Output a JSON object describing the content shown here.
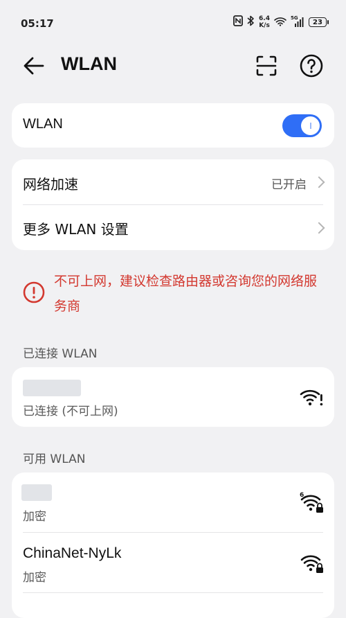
{
  "status_bar": {
    "time": "05:17",
    "net_speed_value": "6.4",
    "net_speed_unit": "K/s",
    "signal_label": "5G",
    "battery": "23"
  },
  "header": {
    "title": "WLAN"
  },
  "wlan_toggle": {
    "label": "WLAN",
    "state": "on"
  },
  "settings": {
    "accel_label": "网络加速",
    "accel_value": "已开启",
    "more_label": "更多 WLAN 设置"
  },
  "warning": {
    "text": "不可上网，建议检查路由器或咨询您的网络服务商"
  },
  "connected": {
    "section_title": "已连接 WLAN",
    "status": "已连接 (不可上网)"
  },
  "available": {
    "section_title": "可用 WLAN",
    "networks": [
      {
        "name": "",
        "security": "加密"
      },
      {
        "name": "ChinaNet-NyLk",
        "security": "加密"
      }
    ]
  },
  "colors": {
    "accent": "#2f6ef6",
    "warning": "#d3382f",
    "background": "#f1f1f3"
  }
}
